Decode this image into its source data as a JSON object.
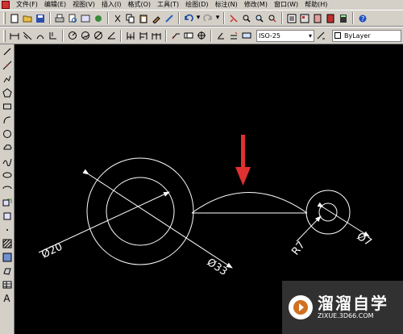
{
  "menu": [
    "文件(F)",
    "编辑(E)",
    "视图(V)",
    "插入(I)",
    "格式(O)",
    "工具(T)",
    "绘图(D)",
    "标注(N)",
    "修改(M)",
    "窗口(W)",
    "帮助(H)"
  ],
  "toolbar2": {
    "dim_style": "ISO-25",
    "layer_label": "ByLayer"
  },
  "drawing": {
    "dim_large_outer": "Ø33",
    "dim_large_inner": "Ø20",
    "dim_small_radius": "R7",
    "dim_small_diameter": "Ø7",
    "line_color": "#ffffff",
    "arrow_color": "#e03030"
  },
  "watermark": {
    "title": "溜溜自学",
    "url": "ZIXUE.3D66.COM"
  }
}
